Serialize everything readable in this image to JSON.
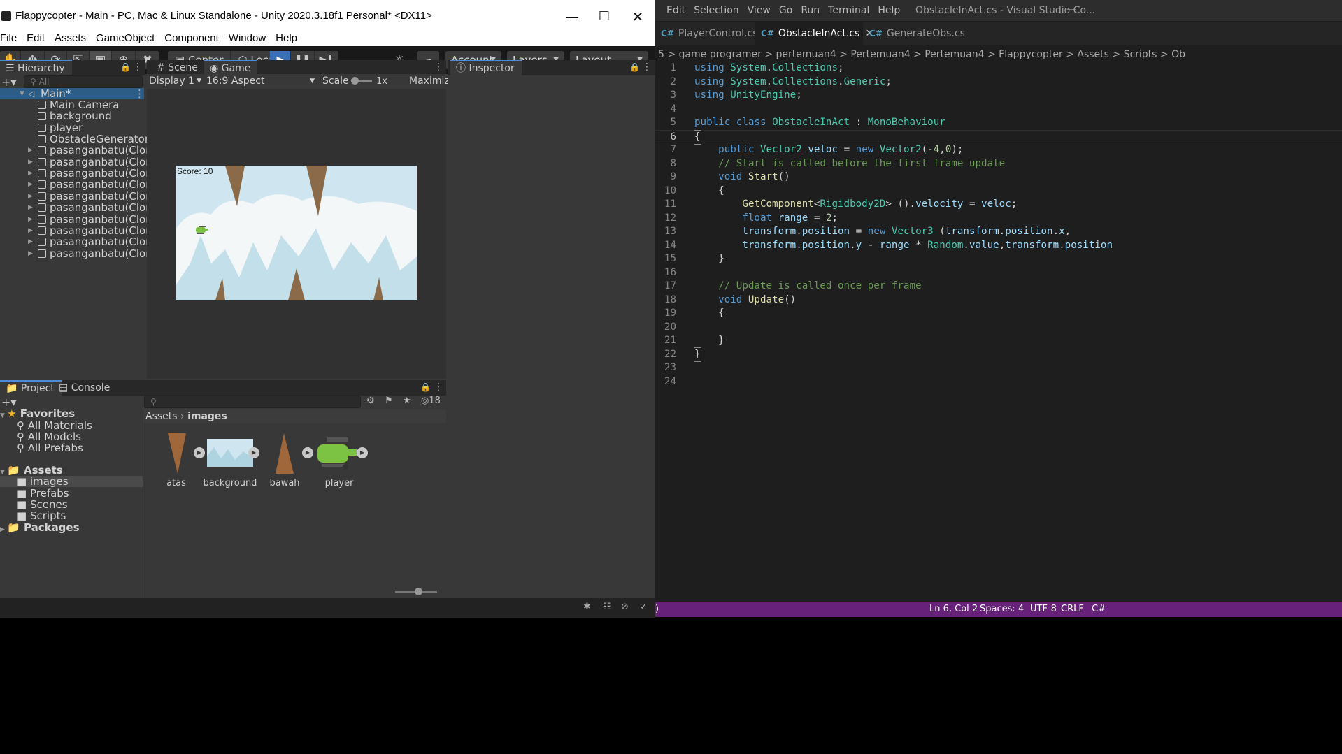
{
  "unity": {
    "window_title": "Flappycopter - Main - PC, Mac & Linux Standalone - Unity 2020.3.18f1 Personal* <DX11>",
    "menu": [
      "File",
      "Edit",
      "Assets",
      "GameObject",
      "Component",
      "Window",
      "Help"
    ],
    "toolbar": {
      "pivot": "Center",
      "space": "Local",
      "account": "Account",
      "layers": "Layers",
      "layout": "Layout"
    },
    "hierarchy": {
      "tab": "Hierarchy",
      "search_placeholder": "All",
      "scene": "Main*",
      "items": [
        "Main Camera",
        "background",
        "player",
        "ObstacleGenerator",
        "pasanganbatu(Clone)",
        "pasanganbatu(Clone)",
        "pasanganbatu(Clone)",
        "pasanganbatu(Clone)",
        "pasanganbatu(Clone)",
        "pasanganbatu(Clone)",
        "pasanganbatu(Clone)",
        "pasanganbatu(Clone)",
        "pasanganbatu(Clone)",
        "pasanganbatu(Clone)"
      ]
    },
    "game_view": {
      "tabs": [
        "Scene",
        "Game"
      ],
      "display": "Display 1",
      "aspect": "16:9 Aspect",
      "scale_label": "Scale",
      "scale_value": "1x",
      "maximize": "Maximize",
      "score_text": "Score: 10"
    },
    "inspector": {
      "tab": "Inspector"
    },
    "project": {
      "tabs": [
        "Project",
        "Console"
      ],
      "hidden_count": "18",
      "favorites_label": "Favorites",
      "favorites": [
        "All Materials",
        "All Models",
        "All Prefabs"
      ],
      "assets_label": "Assets",
      "folders": [
        "images",
        "Prefabs",
        "Scenes",
        "Scripts"
      ],
      "packages_label": "Packages",
      "breadcrumb": [
        "Assets",
        "images"
      ],
      "asset_items": [
        "atas",
        "background",
        "bawah",
        "player"
      ]
    }
  },
  "vscode": {
    "menu": [
      "Edit",
      "Selection",
      "View",
      "Go",
      "Run",
      "Terminal",
      "Help"
    ],
    "window_title": "ObstacleInAct.cs - Visual Studio Co...",
    "tabs": [
      {
        "label": "PlayerControl.cs",
        "active": false
      },
      {
        "label": "ObstacleInAct.cs",
        "active": true
      },
      {
        "label": "GenerateObs.cs",
        "active": false
      }
    ],
    "breadcrumb": "5 > game programer > pertemuan4 > Pertemuan4 > Pertemuan4 > Flappycopter > Assets > Scripts > Ob",
    "current_line": 6,
    "line_numbers": [
      "1",
      "2",
      "3",
      "4",
      "5",
      "6",
      "7",
      "8",
      "9",
      "10",
      "11",
      "12",
      "13",
      "14",
      "15",
      "16",
      "17",
      "18",
      "19",
      "20",
      "21",
      "22",
      "23",
      "24"
    ],
    "status": {
      "position": "Ln 6, Col 2",
      "spaces": "Spaces: 4",
      "encoding": "UTF-8",
      "eol": "CRLF",
      "lang": "C#"
    }
  },
  "colors": {
    "unity_bg": "#383838",
    "unity_toolbar": "#191919",
    "vscode_bg": "#1e1e1e",
    "vscode_status": "#68217a",
    "keyword": "#569cd6",
    "type": "#4ec9b0",
    "comment": "#6a9955"
  }
}
